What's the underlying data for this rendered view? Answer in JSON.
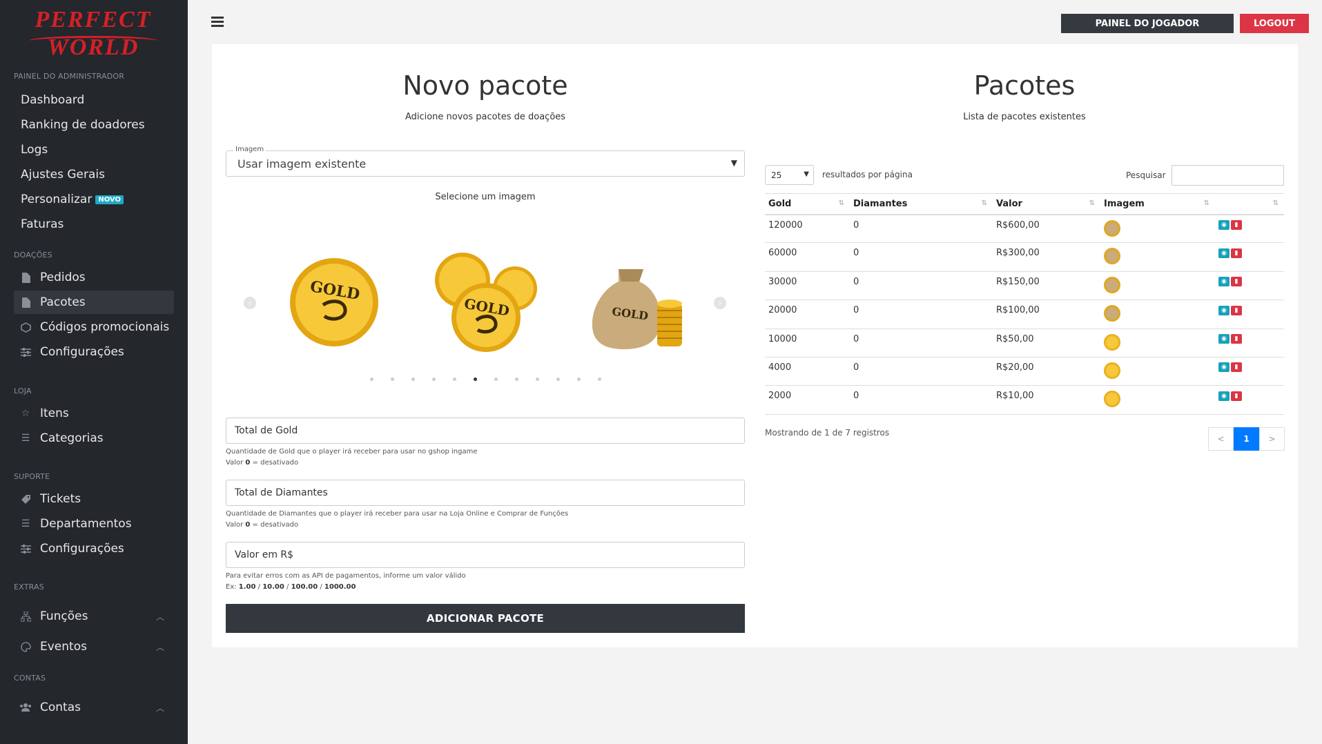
{
  "logo": {
    "line1": "PERFECT",
    "line2": "WORLD"
  },
  "sidebar": {
    "section_admin": "PAINEL DO ADMINISTRADOR",
    "admin_items": [
      "Dashboard",
      "Ranking de doadores",
      "Logs",
      "Ajustes Gerais",
      "Personalizar",
      "Faturas"
    ],
    "personalizar_badge": "NOVO",
    "section_donations": "DOAÇÕES",
    "donation_items": [
      "Pedidos",
      "Pacotes",
      "Códigos promocionais",
      "Configurações"
    ],
    "section_store": "LOJA",
    "store_items": [
      "Itens",
      "Categorias"
    ],
    "section_support": "SUPORTE",
    "support_items": [
      "Tickets",
      "Departamentos",
      "Configurações"
    ],
    "section_extras": "EXTRAS",
    "extras_items": [
      "Funções",
      "Eventos"
    ],
    "section_accounts": "CONTAS",
    "accounts_items": [
      "Contas"
    ]
  },
  "topbar": {
    "player_panel": "PAINEL DO JOGADOR",
    "logout": "LOGOUT"
  },
  "left": {
    "title": "Novo pacote",
    "subtitle": "Adicione novos pacotes de doações",
    "image_label": "Imagem",
    "image_value": "Usar imagem existente",
    "select_prompt": "Selecione um imagem",
    "gold_placeholder": "Total de Gold",
    "gold_help": "Quantidade de Gold que o player irá receber para usar no gshop ingame",
    "gold_help2_pre": "Valor ",
    "gold_help2_b": "0",
    "gold_help2_post": " = desativado",
    "diamonds_placeholder": "Total de Diamantes",
    "diamonds_help": "Quantidade de Diamantes que o player irá receber para usar na Loja Online e Comprar de Funções",
    "diamonds_help2_pre": "Valor ",
    "diamonds_help2_b": "0",
    "diamonds_help2_post": " = desativado",
    "value_placeholder": "Valor em R$",
    "value_help": "Para evitar erros com as API de pagamentos, informe um valor válido",
    "value_help2_pre": "Ex: ",
    "value_help2_b1": "1.00",
    "value_help2_b2": "10.00",
    "value_help2_b3": "100.00",
    "value_help2_b4": "1000.00",
    "sep": " / ",
    "submit": "ADICIONAR PACOTE",
    "coin_text": "GOLD"
  },
  "right": {
    "title": "Pacotes",
    "subtitle": "Lista de pacotes existentes",
    "page_length": "25",
    "page_length_label": "resultados por página",
    "search_label": "Pesquisar",
    "columns": [
      "Gold",
      "Diamantes",
      "Valor",
      "Imagem"
    ],
    "rows": [
      {
        "gold": "120000",
        "diamonds": "0",
        "value": "R$600,00"
      },
      {
        "gold": "60000",
        "diamonds": "0",
        "value": "R$300,00"
      },
      {
        "gold": "30000",
        "diamonds": "0",
        "value": "R$150,00"
      },
      {
        "gold": "20000",
        "diamonds": "0",
        "value": "R$100,00"
      },
      {
        "gold": "10000",
        "diamonds": "0",
        "value": "R$50,00"
      },
      {
        "gold": "4000",
        "diamonds": "0",
        "value": "R$20,00"
      },
      {
        "gold": "2000",
        "diamonds": "0",
        "value": "R$10,00"
      }
    ],
    "info": "Mostrando de 1 de 7 registros",
    "prev": "<",
    "page": "1",
    "next": ">"
  },
  "colors": {
    "sidebar": "#24272c",
    "accent_red": "#dc3545",
    "primary": "#007bff",
    "dark": "#343a40"
  }
}
